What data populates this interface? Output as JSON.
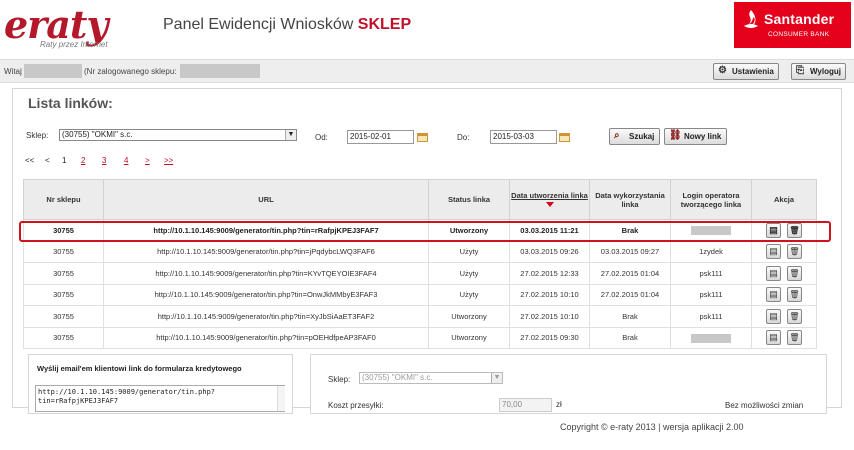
{
  "header": {
    "logo_text": "eraty",
    "logo_tagline": "Raty przez Internet",
    "title_prefix": "Panel Ewidencji Wniosków",
    "title_bold": "SKLEP",
    "bank_name": "Santander",
    "bank_sub": "CONSUMER BANK",
    "brand_color": "#e4001b"
  },
  "userbar": {
    "welcome": "Witaj",
    "logged_label": "(Nr zalogowanego sklepu:",
    "settings_label": "Ustawienia",
    "settings_icon": "gear-icon",
    "logout_label": "Wyloguj",
    "logout_icon": "logout-icon"
  },
  "main": {
    "title": "Lista linków:",
    "filters": {
      "shop_label": "Sklep:",
      "shop_value": "(30755) \"OKMI\" s.c.",
      "from_label": "Od:",
      "from_value": "2015-02-01",
      "to_label": "Do:",
      "to_value": "2015-03-03",
      "search_label": "Szukaj",
      "new_link_label": "Nowy link"
    },
    "pager": {
      "first": "<<",
      "prev": "<",
      "pages": [
        "1",
        "2",
        "3",
        "4"
      ],
      "current": "1",
      "next": ">",
      "last": ">>"
    },
    "table": {
      "headers": {
        "shop": "Nr sklepu",
        "url": "URL",
        "status": "Status linka",
        "created": "Data utworzenia linka",
        "used": "Data wykorzystania linka",
        "operator": "Login operatora tworzącego linka",
        "action": "Akcja"
      },
      "rows": [
        {
          "shop": "30755",
          "url": "http://10.1.10.145:9009/generator/tin.php?tin=rRafpjKPEJ3FAF7",
          "status": "Utworzony",
          "created": "03.03.2015 11:21",
          "used": "Brak",
          "operator": ""
        },
        {
          "shop": "30755",
          "url": "http://10.1.10.145:9009/generator/tin.php?tin=jPqdybcLWQ3FAF6",
          "status": "Użyty",
          "created": "03.03.2015 09:26",
          "used": "03.03.2015 09:27",
          "operator": "1zydek"
        },
        {
          "shop": "30755",
          "url": "http://10.1.10.145:9009/generator/tin.php?tin=KYvTQEYOIE3FAF4",
          "status": "Użyty",
          "created": "27.02.2015 12:33",
          "used": "27.02.2015 01:04",
          "operator": "psk111"
        },
        {
          "shop": "30755",
          "url": "http://10.1.10.145:9009/generator/tin.php?tin=OnwJkMMbyE3FAF3",
          "status": "Użyty",
          "created": "27.02.2015 10:10",
          "used": "27.02.2015 01:04",
          "operator": "psk111"
        },
        {
          "shop": "30755",
          "url": "http://10.1.10.145:9009/generator/tin.php?tin=XyJbSiAaET3FAF2",
          "status": "Utworzony",
          "created": "27.02.2015 10:10",
          "used": "Brak",
          "operator": "psk111"
        },
        {
          "shop": "30755",
          "url": "http://10.1.10.145:9009/generator/tin.php?tin=pOEHdfpeAP3FAF0",
          "status": "Utworzony",
          "created": "27.02.2015 09:30",
          "used": "Brak",
          "operator": ""
        }
      ]
    }
  },
  "email": {
    "title": "Wyślij email'em klientowi link do formularza kredytowego",
    "link_value": "http://10.1.10.145:9009/generator/tin.php?\ntin=rRafpjKPEJ3FAF7"
  },
  "send": {
    "shop_label": "Sklep:",
    "shop_value": "(30755) \"OKMI\" s.c.",
    "cost_label": "Koszt przesyłki:",
    "cost_value": "70,00",
    "currency": "zł",
    "no_change": "Bez możliwości zmian"
  },
  "footer": "Copyright © e-raty 2013 | wersja aplikacji 2.00"
}
